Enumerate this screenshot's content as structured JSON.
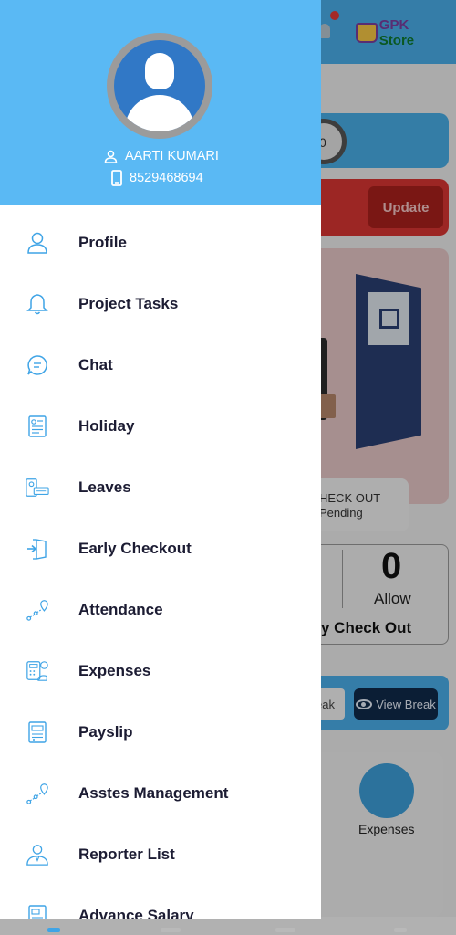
{
  "background": {
    "brand_prefix": "GPK",
    "brand_suffix": "Store",
    "dial_value": "0",
    "update_button": "Update",
    "checkout_status_line1": "HECK OUT",
    "checkout_status_line2": "Pending",
    "counter_value": "0",
    "counter_label": "Allow",
    "counter_title": "y Check Out",
    "break_fragment": "eak",
    "view_break_button": "View Break",
    "expenses_card_label": "Expenses"
  },
  "drawer": {
    "user_name": "AARTI KUMARI",
    "user_phone": "8529468694",
    "menu": [
      {
        "label": "Profile",
        "icon": "person-outline-icon"
      },
      {
        "label": "Project Tasks",
        "icon": "bell-icon"
      },
      {
        "label": "Chat",
        "icon": "chat-bubble-icon"
      },
      {
        "label": "Holiday",
        "icon": "document-icon"
      },
      {
        "label": "Leaves",
        "icon": "leave-card-icon"
      },
      {
        "label": "Early Checkout",
        "icon": "door-exit-icon"
      },
      {
        "label": "Attendance",
        "icon": "location-route-icon"
      },
      {
        "label": "Expenses",
        "icon": "calculator-money-icon"
      },
      {
        "label": "Payslip",
        "icon": "payslip-icon"
      },
      {
        "label": "Asstes Management",
        "icon": "location-route-icon"
      },
      {
        "label": "Reporter List",
        "icon": "businessman-icon"
      },
      {
        "label": "Advance Salary",
        "icon": "salary-document-icon"
      }
    ]
  },
  "colors": {
    "drawer_header": "#5ab9f4",
    "icon_blue": "#3fa4e6",
    "label_dark": "#1c1c33",
    "scrim": "rgba(0,0,0,0.28)"
  }
}
